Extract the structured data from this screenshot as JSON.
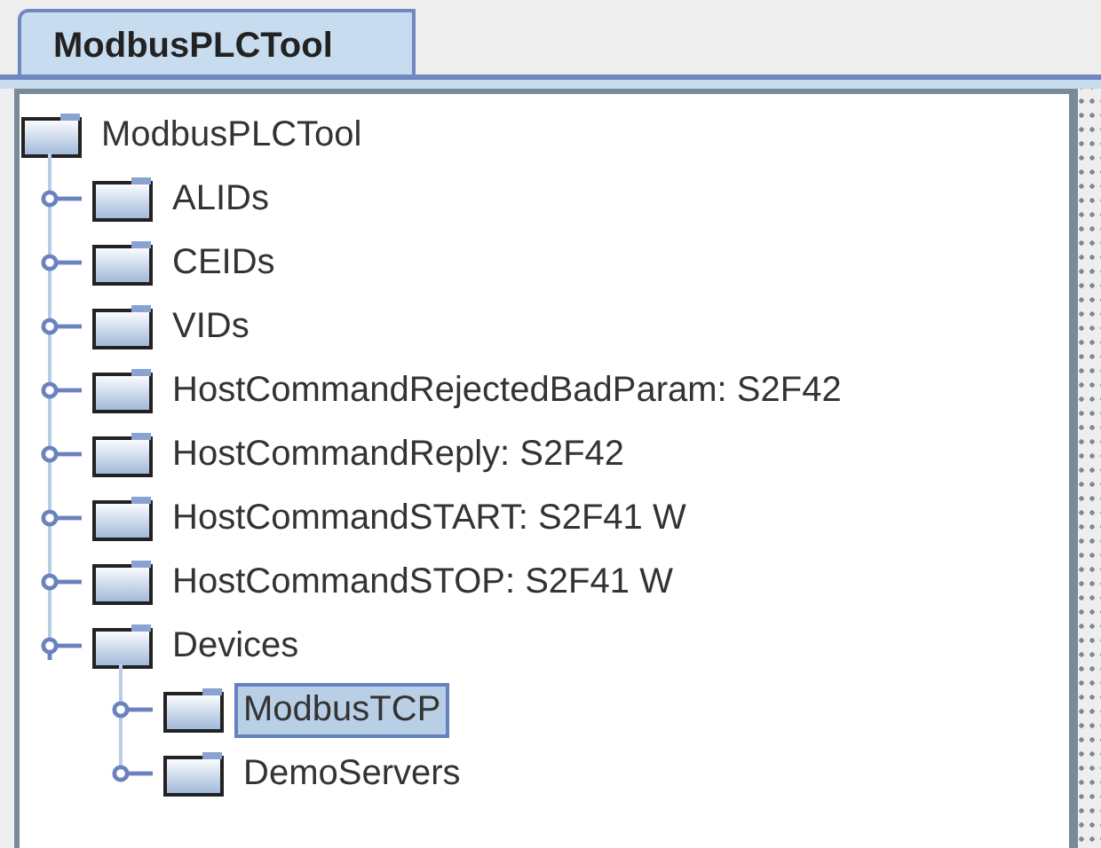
{
  "tab": {
    "label": "ModbusPLCTool",
    "selected": true
  },
  "tree": {
    "label": "ModbusPLCTool",
    "selected": false,
    "expanded": true,
    "children": [
      {
        "label": "ALIDs",
        "selected": false,
        "expanded": false
      },
      {
        "label": "CEIDs",
        "selected": false,
        "expanded": false
      },
      {
        "label": "VIDs",
        "selected": false,
        "expanded": false
      },
      {
        "label": "HostCommandRejectedBadParam: S2F42",
        "selected": false,
        "expanded": false
      },
      {
        "label": "HostCommandReply: S2F42",
        "selected": false,
        "expanded": false
      },
      {
        "label": "HostCommandSTART: S2F41 W",
        "selected": false,
        "expanded": false
      },
      {
        "label": "HostCommandSTOP: S2F41 W",
        "selected": false,
        "expanded": false
      },
      {
        "label": "Devices",
        "selected": false,
        "expanded": true,
        "children": [
          {
            "label": "ModbusTCP",
            "selected": true,
            "expanded": false
          },
          {
            "label": "DemoServers",
            "selected": false,
            "expanded": false
          }
        ]
      }
    ]
  }
}
